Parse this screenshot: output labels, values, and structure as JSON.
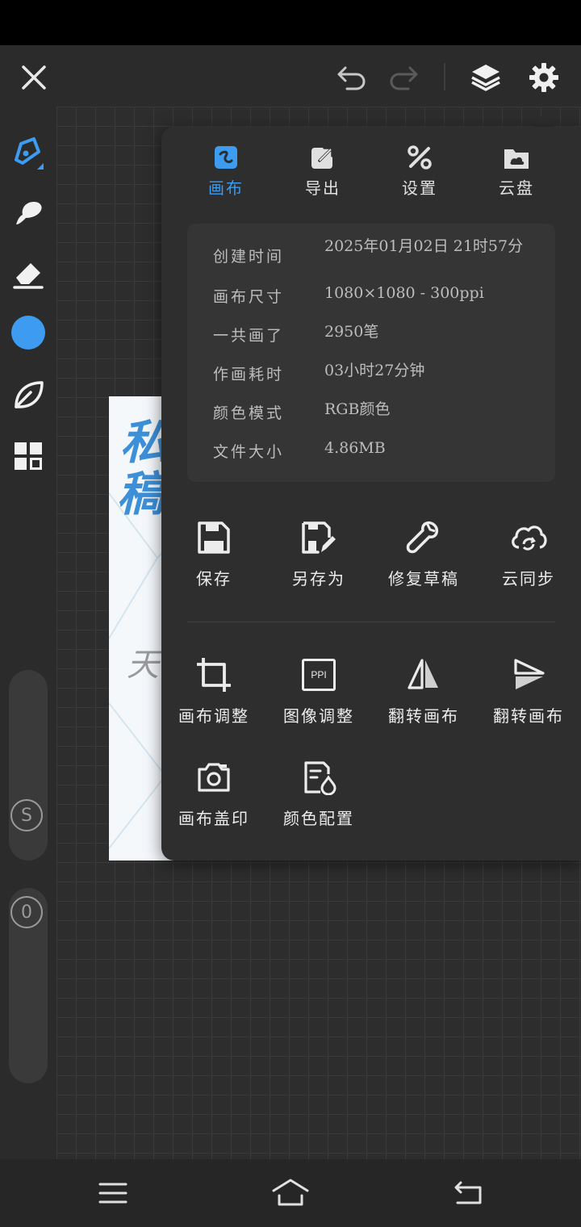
{
  "toolbar": {
    "close_icon": "close-icon",
    "undo_icon": "undo-icon",
    "redo_icon": "redo-icon",
    "layers_icon": "layers-icon",
    "settings_icon": "gear-icon"
  },
  "left_tools": [
    "brush-tool",
    "smudge-tool",
    "eraser-tool",
    "color-picker",
    "leaf-tool",
    "gallery-grid"
  ],
  "active_color": "#3d9bf0",
  "size_slider": {
    "label": "S"
  },
  "opacity_slider": {
    "label": "0"
  },
  "artwork": {
    "text_1": "私",
    "text_2": "稿",
    "text_3": "天"
  },
  "panel": {
    "tabs": [
      {
        "label": "画布",
        "icon": "canvas-icon",
        "active": true
      },
      {
        "label": "导出",
        "icon": "export-icon",
        "active": false
      },
      {
        "label": "设置",
        "icon": "tools-icon",
        "active": false
      },
      {
        "label": "云盘",
        "icon": "cloud-drive-icon",
        "active": false
      }
    ],
    "info": [
      {
        "label": "创建时间",
        "value": "2025年01月02日 21时57分"
      },
      {
        "label": "画布尺寸",
        "value": "1080×1080 - 300ppi"
      },
      {
        "label": "一共画了",
        "value": "2950笔"
      },
      {
        "label": "作画耗时",
        "value": "03小时27分钟"
      },
      {
        "label": "颜色模式",
        "value": "RGB颜色"
      },
      {
        "label": "文件大小",
        "value": "4.86MB"
      }
    ],
    "actions_row1": [
      {
        "label": "保存",
        "icon": "save-icon"
      },
      {
        "label": "另存为",
        "icon": "save-as-icon"
      },
      {
        "label": "修复草稿",
        "icon": "repair-icon"
      },
      {
        "label": "云同步",
        "icon": "cloud-sync-icon"
      }
    ],
    "actions_row2": [
      {
        "label": "画布调整",
        "icon": "crop-icon"
      },
      {
        "label": "图像调整",
        "icon": "ppi-icon",
        "badge": "PPI"
      },
      {
        "label": "翻转画布",
        "icon": "flip-horizontal-icon"
      },
      {
        "label": "翻转画布",
        "icon": "flip-vertical-icon"
      }
    ],
    "actions_row3": [
      {
        "label": "画布盖印",
        "icon": "camera-icon"
      },
      {
        "label": "颜色配置",
        "icon": "color-profile-icon"
      }
    ]
  },
  "nav": {
    "menu_icon": "menu-icon",
    "home_icon": "home-icon",
    "back_icon": "back-icon"
  }
}
